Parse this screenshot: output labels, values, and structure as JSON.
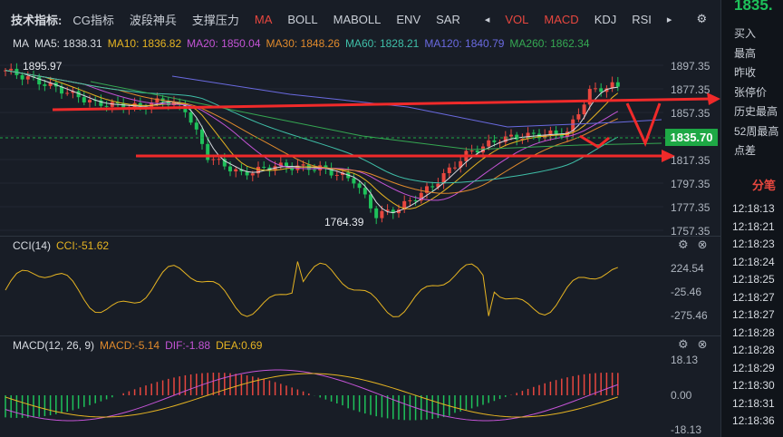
{
  "tabs": {
    "label": "技术指标:",
    "items": [
      "CG指标",
      "波段神兵",
      "支撑压力",
      "MA",
      "BOLL",
      "MABOLL",
      "ENV",
      "SAR"
    ],
    "items_right": [
      "VOL",
      "MACD",
      "KDJ",
      "RSI"
    ],
    "active": "MA",
    "red": [
      "MA",
      "VOL",
      "MACD"
    ]
  },
  "ma_legend": [
    {
      "text": "MA",
      "color": "#d7dbe1"
    },
    {
      "text": "MA5: 1838.31",
      "color": "#d7dbe1"
    },
    {
      "text": "MA10: 1836.82",
      "color": "#e6b422"
    },
    {
      "text": "MA20: 1850.04",
      "color": "#c454d6"
    },
    {
      "text": "MA30: 1848.26",
      "color": "#e08a2c"
    },
    {
      "text": "MA60: 1828.21",
      "color": "#3fbfa8"
    },
    {
      "text": "MA120: 1840.79",
      "color": "#6a6ae0"
    },
    {
      "text": "MA260: 1862.34",
      "color": "#35a852"
    }
  ],
  "price_axis": [
    "1897.35",
    "1877.35",
    "1857.35",
    "1837.35",
    "1817.35",
    "1797.35",
    "1777.35",
    "1757.35"
  ],
  "current_price": "1835.70",
  "annotations": {
    "high": "1895.97",
    "low": "1764.39"
  },
  "cci": {
    "legend": [
      {
        "text": "CCI(14)",
        "color": "#d7dbe1"
      },
      {
        "text": "CCI:-51.62",
        "color": "#e6b422"
      }
    ],
    "axis": [
      "224.54",
      "-25.46",
      "-275.46"
    ]
  },
  "macd": {
    "legend": [
      {
        "text": "MACD(12, 26, 9)",
        "color": "#d7dbe1"
      },
      {
        "text": "MACD:-5.14",
        "color": "#e08a2c"
      },
      {
        "text": "DIF:-1.88",
        "color": "#c454d6"
      },
      {
        "text": "DEA:0.69",
        "color": "#e6b422"
      }
    ],
    "axis": [
      "18.13",
      "0.00",
      "-18.13"
    ]
  },
  "sidebar": {
    "top_price": "1835.",
    "quote_labels": [
      "买入",
      "最高",
      "昨收",
      "张停价",
      "历史最高",
      "52周最高",
      "点差"
    ],
    "fenbi_title": "分笔",
    "times": [
      "12:18:13",
      "12:18:21",
      "12:18:23",
      "12:18:24",
      "12:18:25",
      "12:18:27",
      "12:18:27",
      "12:18:28",
      "12:18:28",
      "12:18:29",
      "12:18:30",
      "12:18:31",
      "12:18:36"
    ]
  },
  "colors": {
    "up": "#e8473f",
    "down": "#1ec15a",
    "arrow": "#f02a2a"
  },
  "icons": {
    "gear": "gear-icon",
    "close": "close-icon",
    "prev": "triangle-left-icon",
    "next": "triangle-right-icon"
  }
}
